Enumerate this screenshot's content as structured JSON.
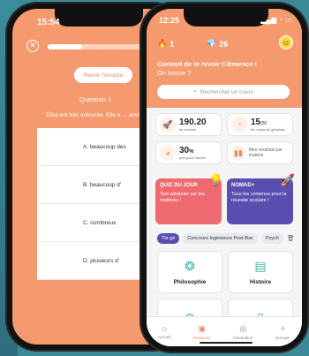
{
  "back_screen": {
    "time": "15:54",
    "progress_count": "1/",
    "progress_fraction": 0.35,
    "revoir_label": "Revoir l'énoncé",
    "question_title": "Question 1",
    "question_text": "Élisa est très entourée. Elle a ... amis.",
    "answers": [
      "A. beaucoup des",
      "B. beaucoup d'",
      "C. nombreux",
      "D. plusieurs d'"
    ]
  },
  "front_screen": {
    "time": "12:25",
    "streak": "1",
    "gems": "26",
    "greeting": "Content de te revoir Clémence !",
    "greeting_sub": "On bosse ?",
    "search_placeholder": "Rechercher un cours",
    "stats": [
      {
        "icon": "rocket-icon",
        "value": "190.20",
        "unit": "de révision"
      },
      {
        "icon": "gauge-icon",
        "value": "15",
        "suffix": "/20",
        "unit": "de moyenne générale"
      },
      {
        "icon": "pie-icon",
        "value": "30",
        "suffix": "%",
        "unit": "prêt pour l'année"
      },
      {
        "icon": "bar-chart-icon",
        "value": "",
        "unit": "Mes résultats par matière"
      }
    ],
    "cards": [
      {
        "title": "QUIZ DU JOUR",
        "desc": "Test aléatoire sur tes matières !"
      },
      {
        "title": "NOMAD+",
        "desc": "Tous les contenus pour la réussite scolaire !"
      }
    ],
    "filters": [
      "Tle gé",
      "Concours Ingénieurs Post-Bac",
      "Psych"
    ],
    "subjects": [
      "Philosophie",
      "Histoire",
      "",
      ""
    ],
    "tabs": [
      "Accueil",
      "Révisions",
      "Orientation",
      "Nomad+"
    ]
  }
}
